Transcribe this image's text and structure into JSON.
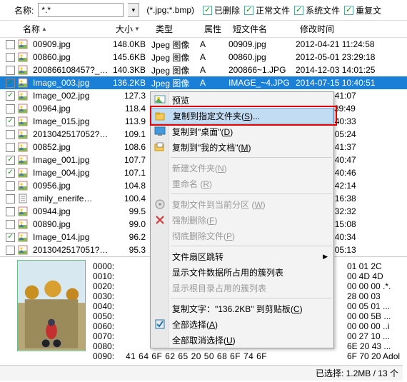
{
  "topbar": {
    "name_label": "名称:",
    "name_value": "*.*",
    "filter_text": "(*.jpg;*.bmp)",
    "checks": [
      {
        "label": "已删除",
        "checked": true
      },
      {
        "label": "正常文件",
        "checked": true
      },
      {
        "label": "系统文件",
        "checked": true
      },
      {
        "label": "重复文",
        "checked": true
      }
    ]
  },
  "columns": {
    "name": "名称",
    "size": "大小",
    "type": "类型",
    "attr": "属性",
    "short": "短文件名",
    "time": "修改时间"
  },
  "rows": [
    {
      "chk": false,
      "name": "00909.jpg",
      "size": "148.0KB",
      "type": "Jpeg 图像",
      "attr": "A",
      "short": "00909.jpg",
      "time": "2012-04-21 11:24:58",
      "sel": false
    },
    {
      "chk": false,
      "name": "00860.jpg",
      "size": "145.6KB",
      "type": "Jpeg 图像",
      "attr": "A",
      "short": "00860.jpg",
      "time": "2012-05-01 23:29:18",
      "sel": false
    },
    {
      "chk": false,
      "name": "200866108457?_…",
      "size": "140.3KB",
      "type": "Jpeg 图像",
      "attr": "A",
      "short": "200866~1.JPG",
      "time": "2014-12-03 14:01:25",
      "sel": false
    },
    {
      "chk": true,
      "name": "Image_003.jpg",
      "size": "136.2KB",
      "type": "Jpeg 图像",
      "attr": "A",
      "short": "IMAGE_~4.JPG",
      "time": "2014-07-15 10:40:51",
      "sel": true
    },
    {
      "chk": true,
      "name": "Image_002.jpg",
      "size": "127.3",
      "type": "",
      "attr": "",
      "short": "",
      "time": "-07-15 10:41:07",
      "sel": false
    },
    {
      "chk": false,
      "name": "00964.jpg",
      "size": "118.4",
      "type": "",
      "attr": "",
      "short": "",
      "time": "-04-26 11:39:49",
      "sel": false
    },
    {
      "chk": true,
      "name": "Image_015.jpg",
      "size": "113.9",
      "type": "",
      "attr": "",
      "short": "",
      "time": "-07-15 10:40:33",
      "sel": false
    },
    {
      "chk": false,
      "name": "2013042517052?…",
      "size": "109.1",
      "type": "",
      "attr": "",
      "short": "",
      "time": "-04-25 17:05:24",
      "sel": false
    },
    {
      "chk": false,
      "name": "00852.jpg",
      "size": "108.6",
      "type": "",
      "attr": "",
      "short": "",
      "time": "-04-10 17:41:37",
      "sel": false
    },
    {
      "chk": true,
      "name": "Image_001.jpg",
      "size": "107.7",
      "type": "",
      "attr": "",
      "short": "",
      "time": "-07-15 10:40:47",
      "sel": false
    },
    {
      "chk": true,
      "name": "Image_004.jpg",
      "size": "107.1",
      "type": "",
      "attr": "",
      "short": "",
      "time": "-07-15 10:40:46",
      "sel": false
    },
    {
      "chk": false,
      "name": "00956.jpg",
      "size": "104.8",
      "type": "",
      "attr": "",
      "short": "",
      "time": "-05-16 20:42:14",
      "sel": false
    },
    {
      "chk": false,
      "name": "amily_enerife…",
      "size": "100.4",
      "type": "",
      "attr": "",
      "short": "",
      "time": "-03-20 09:16:38",
      "sel": false
    },
    {
      "chk": false,
      "name": "00944.jpg",
      "size": "99.5",
      "type": "",
      "attr": "",
      "short": "",
      "time": "-04-21 16:32:32",
      "sel": false
    },
    {
      "chk": false,
      "name": "00890.jpg",
      "size": "99.0",
      "type": "",
      "attr": "",
      "short": "",
      "time": "-03-25 19:15:08",
      "sel": false
    },
    {
      "chk": true,
      "name": "Image_014.jpg",
      "size": "96.2",
      "type": "",
      "attr": "",
      "short": "",
      "time": "-07-15 10:40:34",
      "sel": false
    },
    {
      "chk": false,
      "name": "2013042517051?…",
      "size": "95.3",
      "type": "",
      "attr": "",
      "short": "",
      "time": "-04-25 17:05:13",
      "sel": false
    }
  ],
  "context_menu": {
    "items": [
      {
        "label": "预览",
        "icon": "preview",
        "disabled": false,
        "hl": false
      },
      {
        "label_html": "复制到指定文件夹(<u class='access'>S</u>)...",
        "icon": "copy-folder",
        "disabled": false,
        "hl": true
      },
      {
        "label_html": "复制到\"桌面\"(<u class='access'>D</u>)",
        "icon": "copy-desktop",
        "disabled": false,
        "hl": false
      },
      {
        "label_html": "复制到\"我的文档\"(<u class='access'>M</u>)",
        "icon": "copy-docs",
        "disabled": false,
        "hl": false
      },
      {
        "sep": true
      },
      {
        "label_html": "新建文件夹(<u class='access'>N</u>)",
        "icon": "",
        "disabled": true,
        "hl": false
      },
      {
        "label_html": "重命名 (<u class='access'>R</u>)",
        "icon": "",
        "disabled": true,
        "hl": false
      },
      {
        "sep": true
      },
      {
        "label_html": "复制文件到当前分区 (<u class='access'>W</u>)",
        "icon": "partition",
        "disabled": true,
        "hl": false
      },
      {
        "label_html": "强制删除(<u class='access'>F</u>)",
        "icon": "force-del",
        "disabled": true,
        "hl": false
      },
      {
        "label_html": "彻底删除文件(<u class='access'>P</u>)",
        "icon": "",
        "disabled": true,
        "hl": false
      },
      {
        "sep": true
      },
      {
        "label": "文件扇区跳转",
        "icon": "",
        "disabled": false,
        "hl": false,
        "submenu": true
      },
      {
        "label": "显示文件数据所占用的簇列表",
        "icon": "",
        "disabled": false,
        "hl": false
      },
      {
        "label": "显示根目录占用的簇列表",
        "icon": "",
        "disabled": true,
        "hl": false
      },
      {
        "sep": true
      },
      {
        "label_html": "复制文字：\"136.2KB\" 到剪贴板(<u class='access'>C</u>)",
        "icon": "",
        "disabled": false,
        "hl": false
      },
      {
        "label_html": "全部选择(<u class='access'>A</u>)",
        "icon": "select-all",
        "disabled": false,
        "hl": false
      },
      {
        "label_html": "全部取消选择(<u class='access'>U</u>)",
        "icon": "",
        "disabled": false,
        "hl": false
      }
    ]
  },
  "hex": {
    "lines": [
      {
        "addr": "0000:",
        "bytes": "",
        "ascii": "01 01 2C"
      },
      {
        "addr": "0010:",
        "bytes": "",
        "ascii": "00 4D 4D"
      },
      {
        "addr": "0020:",
        "bytes": "",
        "ascii": "00 00 00 .*."
      },
      {
        "addr": "0030:",
        "bytes": "",
        "ascii": "28 00 03"
      },
      {
        "addr": "0040:",
        "bytes": "",
        "ascii": "00 05 01 ..."
      },
      {
        "addr": "0050:",
        "bytes": "",
        "ascii": "00 00 5B ..."
      },
      {
        "addr": "0060:",
        "bytes": "",
        "ascii": "00 00 00 ..i"
      },
      {
        "addr": "0070:",
        "bytes": "",
        "ascii": "00 27 10 ..."
      },
      {
        "addr": "0080:",
        "bytes": "",
        "ascii": "6E 20 43 ..."
      },
      {
        "addr": "0090:",
        "bytes": "41 64 6F 62 65 20 50 68 6F 74 6F",
        "ascii": "6F 70 20 Adol"
      }
    ]
  },
  "status": {
    "text": "已选择: 1.2MB / 13 个"
  }
}
